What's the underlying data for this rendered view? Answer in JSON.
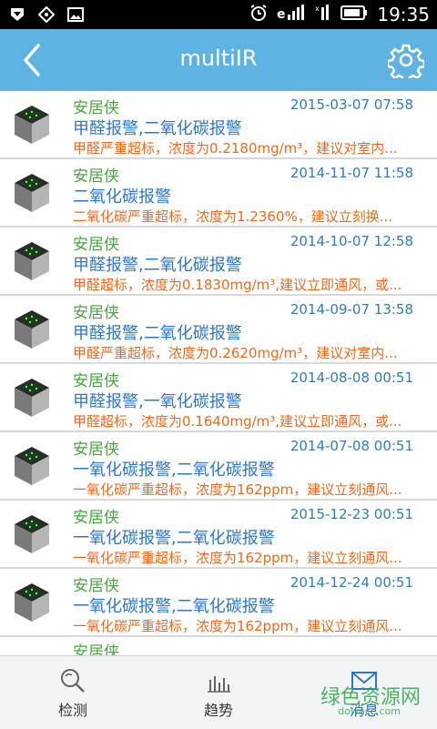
{
  "status_bar": {
    "time": "19:35"
  },
  "header": {
    "title": "multiIR"
  },
  "messages": [
    {
      "sender": "安居侠",
      "time": "2015-03-07 07:58",
      "title": "甲醛报警,二氧化碳报警",
      "detail": "甲醛严重超标，浓度为0.2180mg/m³，建议对室内..."
    },
    {
      "sender": "安居侠",
      "time": "2014-11-07 11:58",
      "title": "二氧化碳报警",
      "detail": "二氧化碳严重超标，浓度为1.2360%，建议立刻换..."
    },
    {
      "sender": "安居侠",
      "time": "2014-10-07 12:58",
      "title": "甲醛报警,二氧化碳报警",
      "detail": "甲醛超标，浓度为0.1830mg/m³,建议立即通风，或..."
    },
    {
      "sender": "安居侠",
      "time": "2014-09-07 13:58",
      "title": "甲醛报警,二氧化碳报警",
      "detail": "甲醛严重超标，浓度为0.2620mg/m³，建议对室内..."
    },
    {
      "sender": "安居侠",
      "time": "2014-08-08 00:51",
      "title": "甲醛报警,一氧化碳报警",
      "detail": "甲醛超标，浓度为0.1640mg/m³,建议立即通风，或..."
    },
    {
      "sender": "安居侠",
      "time": "2014-07-08 00:51",
      "title": "一氧化碳报警,二氧化碳报警",
      "detail": "一氧化碳严重超标，浓度为162ppm，建议立刻通风..."
    },
    {
      "sender": "安居侠",
      "time": "2015-12-23 00:51",
      "title": "一氧化碳报警,二氧化碳报警",
      "detail": "一氧化碳严重超标，浓度为162ppm，建议立刻通风..."
    },
    {
      "sender": "安居侠",
      "time": "2014-12-24 00:51",
      "title": "一氧化碳报警,二氧化碳报警",
      "detail": "一氧化碳严重超标，浓度为162ppm，建议立刻通风..."
    }
  ],
  "partial_row": {
    "sender": "安居侠"
  },
  "tabs": [
    {
      "label": "检测",
      "icon": "magnifier-icon"
    },
    {
      "label": "趋势",
      "icon": "bar-chart-icon"
    },
    {
      "label": "消息",
      "icon": "envelope-icon",
      "active": true
    }
  ],
  "watermark": {
    "text": "绿色资源网",
    "sub": "downcc.com"
  },
  "colors": {
    "header": "#5fb3e3",
    "sender": "#4aa53f",
    "title": "#2d78c8",
    "detail": "#ee6a1a"
  }
}
